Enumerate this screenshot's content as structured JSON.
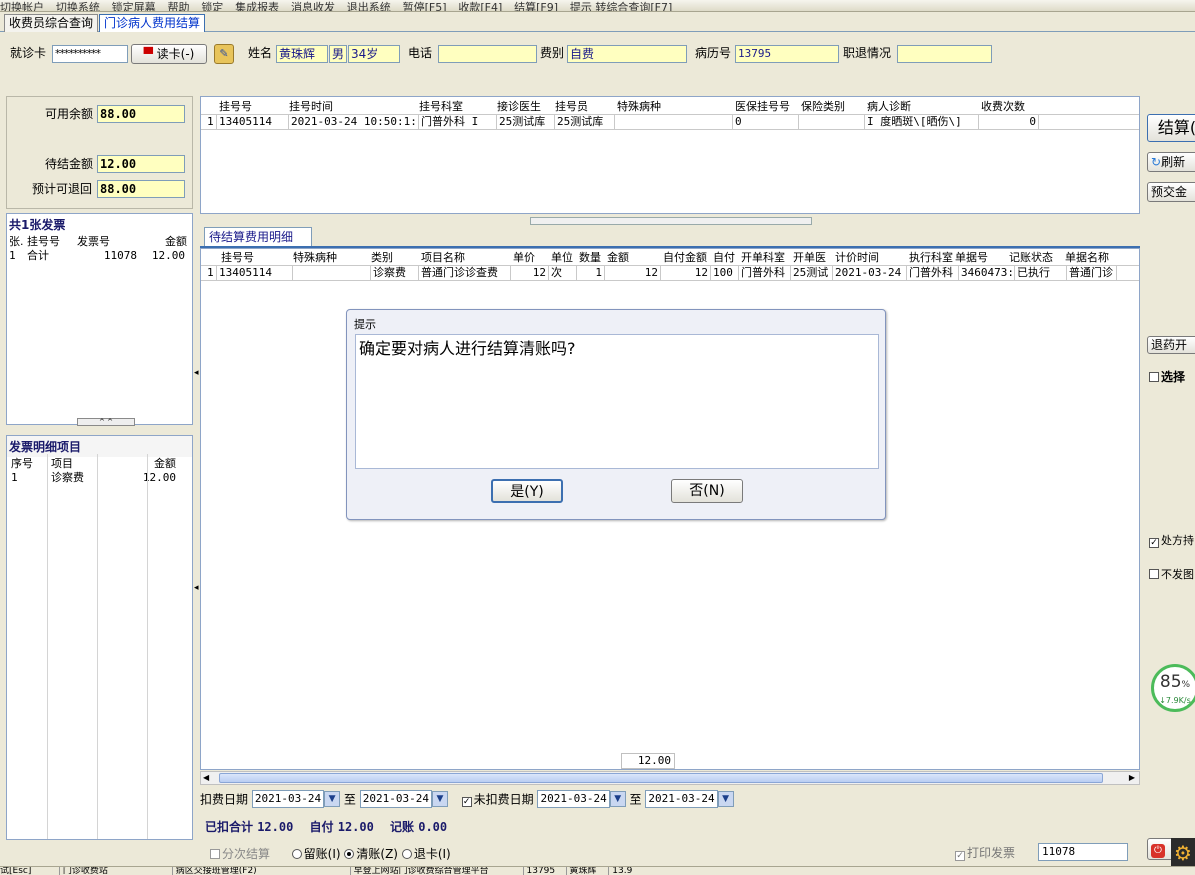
{
  "toolbar": {
    "items": [
      "切换帐户",
      "切换系统",
      "锁定屏幕",
      "帮助",
      "锁定",
      "集成报表",
      "消息收发",
      "退出系统",
      "暂停[F5]",
      "收款[F4]",
      "结算[F9]",
      "提示 转综合查询[F7]"
    ]
  },
  "tabs": [
    {
      "label": "收费员综合查询",
      "active": false
    },
    {
      "label": "门诊病人费用结算",
      "active": true
    }
  ],
  "patient": {
    "card_label": "就诊卡",
    "card_value": "**********",
    "read_card_label": "读卡(-)",
    "name_label": "姓名",
    "name_value": "黄珠辉",
    "sex_value": "男",
    "age_value": "34岁",
    "phone_label": "电话",
    "phone_value": "",
    "fee_type_label": "费别",
    "fee_type_value": "自费",
    "record_label": "病历号",
    "record_value": "13795",
    "retire_label": "职退情况",
    "retire_value": ""
  },
  "balance": {
    "available_label": "可用余额",
    "available_value": "88.00",
    "pending_label": "待结金额",
    "pending_value": "12.00",
    "refund_label": "预计可退回",
    "refund_value": "88.00"
  },
  "registration": {
    "headers": [
      "挂号号",
      "挂号时间",
      "挂号科室",
      "接诊医生",
      "挂号员",
      "特殊病种",
      "医保挂号号",
      "保险类别",
      "病人诊断",
      "收费次数"
    ],
    "rows": [
      [
        "1",
        "13405114",
        "2021-03-24 10:50:1:",
        "门普外科 I",
        "25测试库",
        "25测试库",
        "",
        "0",
        "",
        "I 度晒斑\\[晒伤\\]",
        "0"
      ]
    ]
  },
  "invoices": {
    "title": "共1张发票",
    "headers": [
      "张.",
      "挂号号",
      "发票号",
      "金额"
    ],
    "rows": [
      [
        "1",
        "合计",
        "11078",
        "12.00"
      ]
    ]
  },
  "invoice_detail": {
    "title": "发票明细项目",
    "headers": [
      "序号",
      "项目",
      "金额"
    ],
    "rows": [
      [
        "1",
        "诊察费",
        "12.00"
      ]
    ]
  },
  "pending_detail": {
    "tab_label": "待结算费用明细",
    "headers": [
      "挂号号",
      "特殊病种",
      "类别",
      "项目名称",
      "单价",
      "单位",
      "数量",
      "金额",
      "自付金额",
      "自付",
      "开单科室",
      "开单医",
      "计价时间",
      "执行科室",
      "单据号",
      "记账状态",
      "单据名称"
    ],
    "rows": [
      [
        "1",
        "13405114",
        "",
        "诊察费",
        "普通门诊诊查费",
        "12",
        "次",
        "1",
        "12",
        "12",
        "100",
        "门普外科",
        "25测试",
        "2021-03-24",
        "门普外科",
        "3460473:",
        "已执行",
        "普通门诊"
      ]
    ],
    "total": "12.00"
  },
  "filters": {
    "deduct_date_label": "扣费日期",
    "deduct_from": "2021-03-24",
    "to_label": "至",
    "deduct_to": "2021-03-24",
    "undeducted_label": "未扣费日期",
    "undeducted_from": "2021-03-24",
    "undeducted_to": "2021-03-24"
  },
  "summary": {
    "deducted_label": "已扣合计",
    "deducted_value": "12.00",
    "selfpay_label": "自付",
    "selfpay_value": "12.00",
    "account_label": "记账",
    "account_value": "0.00"
  },
  "options": {
    "split_label": "分次结算",
    "keep_label": "留账(I)",
    "clear_label": "清账(Z)",
    "refund_card_label": "退卡(I)",
    "print_invoice_label": "打印发票",
    "invoice_no": "11078"
  },
  "right_panel": {
    "settle_label": "结算(",
    "refresh_label": "刷新",
    "prepay_label": "预交金",
    "refund_drug_label": "退药开",
    "select_label": "选择",
    "prescription_label": "处方持",
    "no_send_label": "不发图"
  },
  "widget": {
    "percent": "85",
    "unit": "%",
    "speed": "7.9K/s"
  },
  "dialog": {
    "title": "提示",
    "message": "确定要对病人进行结算清账吗?",
    "yes_label": "是(Y)",
    "no_label": "否(N)"
  },
  "statusbar": {
    "items": [
      "试[Esc]",
      "门诊收费站",
      "病区交接班管理(F2)",
      "",
      "早登上网站门诊收费综合管理平台",
      "",
      "13795",
      "黄珠辉",
      "13.9"
    ]
  }
}
